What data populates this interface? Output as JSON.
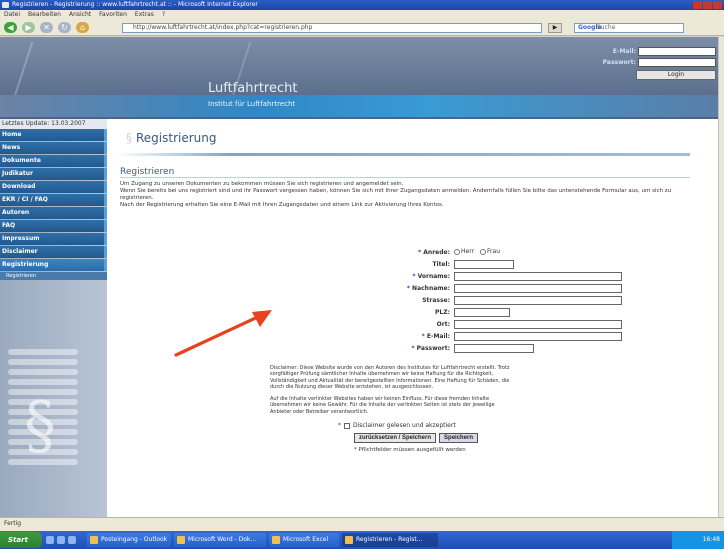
{
  "browser": {
    "title": "Registrieren - Registrierung :: www.luftfahrtrecht.at :: - Microsoft Internet Explorer",
    "menu": [
      "Datei",
      "Bearbeiten",
      "Ansicht",
      "Favoriten",
      "Extras",
      "?"
    ],
    "address": "http://www.luftfahrtrecht.at/index.php?cat=registrieren.php",
    "go_label": "Wechseln zu",
    "search_label": "Google",
    "search_placeholder": "Suche",
    "status": "Fertig"
  },
  "header": {
    "brand": "Luftfahrtrecht",
    "subtitle": "Institut für Luftfahrtrecht",
    "email_label": "E-Mail:",
    "password_label": "Passwort:",
    "login_label": "Login"
  },
  "sidebar": {
    "update": "Letztes Update: 13.03.2007",
    "items": [
      {
        "label": "Home"
      },
      {
        "label": "News"
      },
      {
        "label": "Dokumente"
      },
      {
        "label": "Judikatur"
      },
      {
        "label": "Download"
      },
      {
        "label": "EKR / CI / FAQ"
      },
      {
        "label": "Autoren"
      },
      {
        "label": "FAQ"
      },
      {
        "label": "Impressum"
      },
      {
        "label": "Disclaimer"
      },
      {
        "label": "Registrierung"
      }
    ],
    "subitem": "Registrieren"
  },
  "main": {
    "page_title": "Registrierung",
    "section_title": "Registrieren",
    "intro": [
      "Um Zugang zu unseren Dokumenten zu bekommen müssen Sie sich registrieren und angemeldet sein.",
      "Wenn Sie bereits bei uns registriert sind und ihr Passwort vergessen haben, können Sie sich mit Ihrer Zugangsdaten anmelden. Andernfalls füllen Sie bitte das untenstehende Formular aus, um sich zu registrieren.",
      "Nach der Registrierung erhalten Sie eine E-Mail mit Ihren Zugangsdaten und einem Link zur Aktivierung Ihres Kontos."
    ],
    "form": {
      "anrede_label": "Anrede:",
      "anrede_options": [
        "Herr",
        "Frau"
      ],
      "titel_label": "Titel:",
      "vorname_label": "Vorname:",
      "nachname_label": "Nachname:",
      "strasse_label": "Strasse:",
      "plz_label": "PLZ:",
      "ort_label": "Ort:",
      "email_label": "E-Mail:",
      "passwort_label": "Passwort:",
      "required_marker": "*"
    },
    "disclaimer": [
      "Disclaimer: Diese Website wurde von den Autoren des Institutes für Luftfahrtrecht erstellt. Trotz sorgfältiger Prüfung sämtlicher Inhalte übernehmen wir keine Haftung für die Richtigkeit, Vollständigkeit und Aktualität der bereitgestellten Informationen. Eine Haftung für Schäden, die durch die Nutzung dieser Website entstehen, ist ausgeschlossen.",
      "Auf die Inhalte verlinkter Websites haben wir keinen Einfluss. Für diese fremden Inhalte übernehmen wir keine Gewähr. Für die Inhalte der verlinkten Seiten ist stets der jeweilige Anbieter oder Betreiber verantwortlich."
    ],
    "disclaimer_lead": "Disclaimer:",
    "agree_label": "Disclaimer gelesen und akzeptiert",
    "reset_label": "zurücksetzen / Speichern",
    "save_label": "Speichern",
    "required_note": "* Pflichtfelder müssen ausgefüllt werden"
  },
  "taskbar": {
    "start_label": "Start",
    "tasks": [
      {
        "label": "Posteingang - Outlook"
      },
      {
        "label": "Microsoft Word - Dok..."
      },
      {
        "label": "Microsoft Excel"
      },
      {
        "label": "Registrieren - Regist..."
      }
    ],
    "clock": "16:48"
  },
  "colors": {
    "accent": "#2f6fa8",
    "arrow": "#e8411e",
    "heading": "#3a5a82"
  }
}
